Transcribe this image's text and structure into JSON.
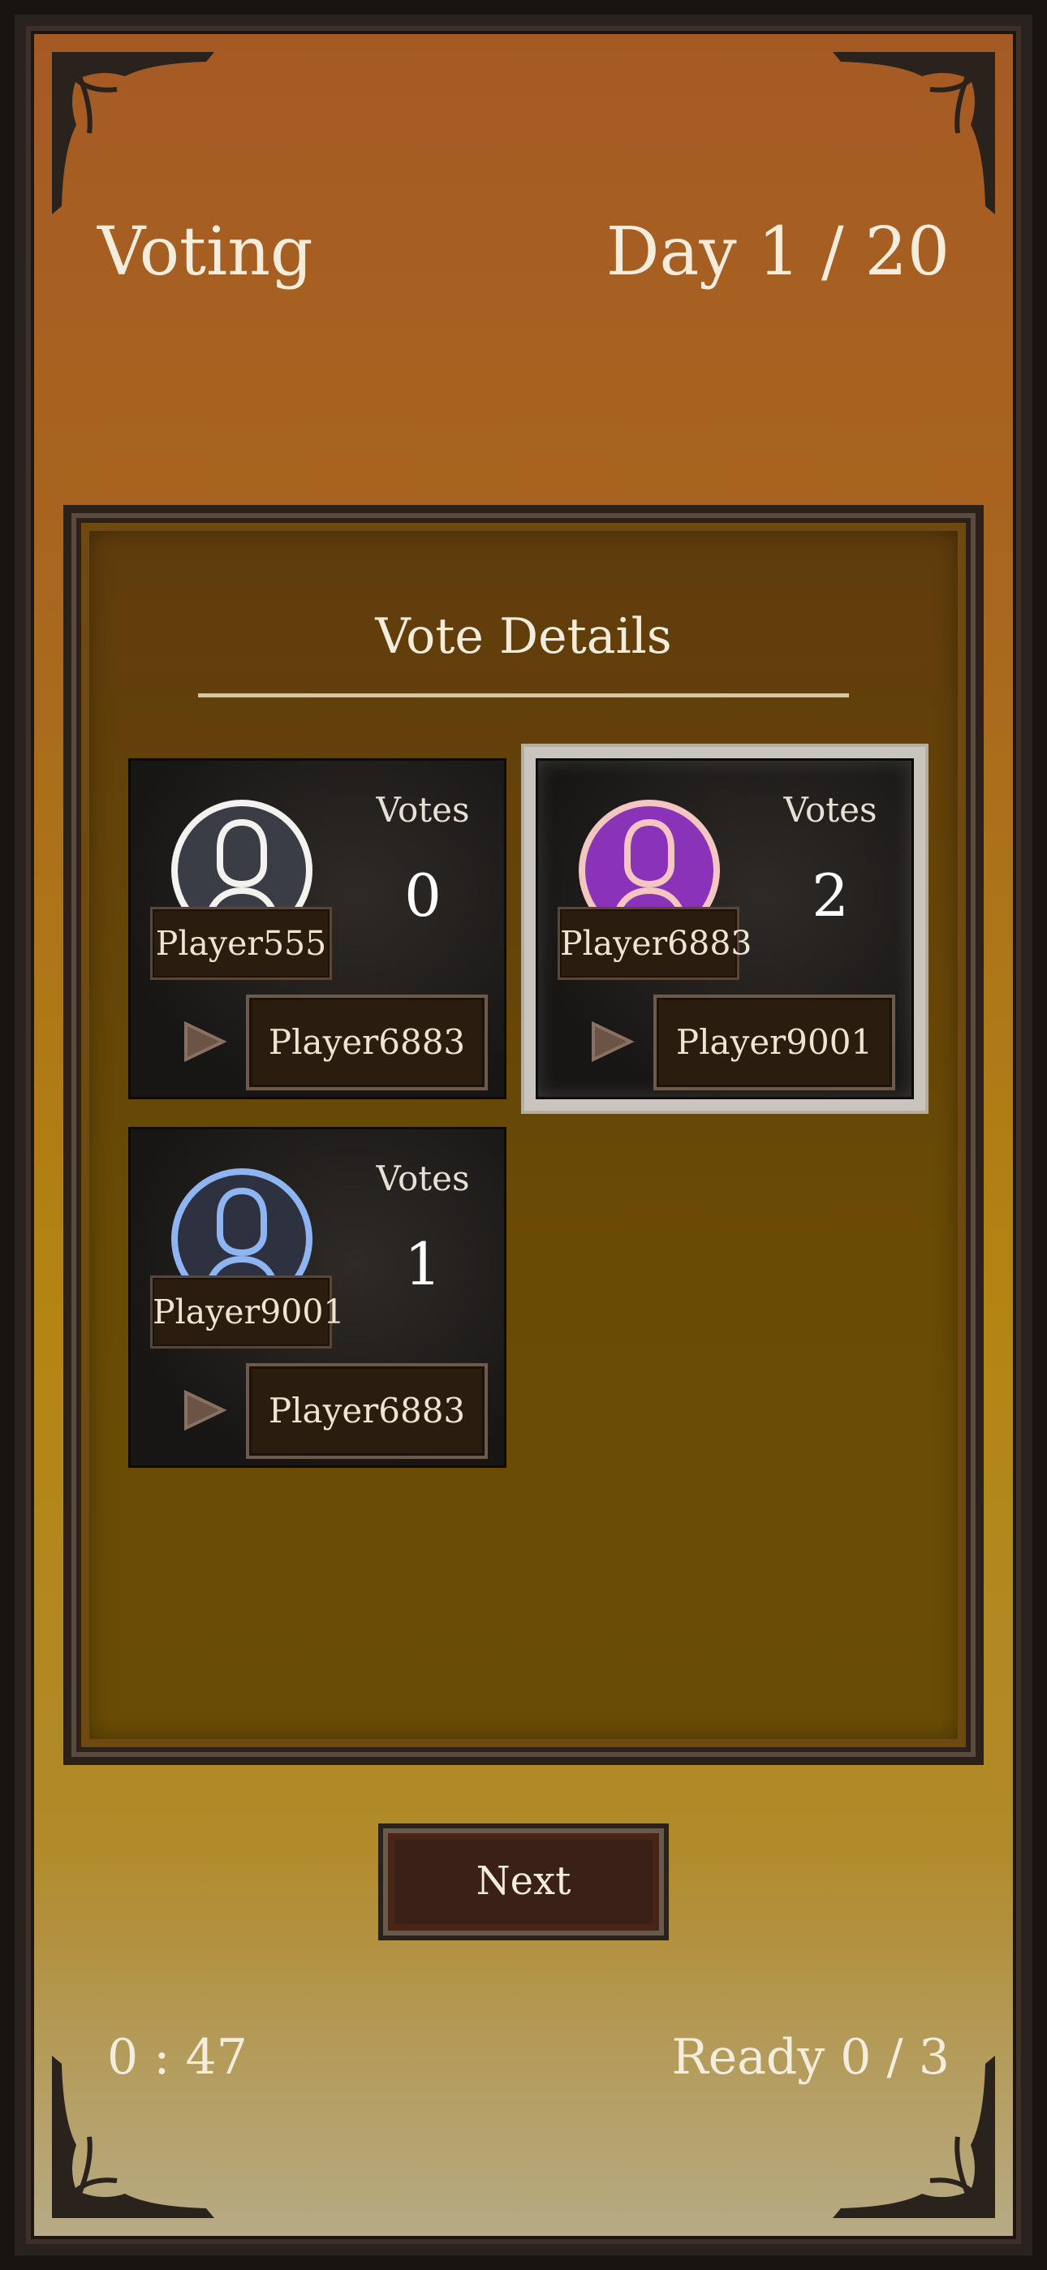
{
  "header": {
    "phase": "Voting",
    "day": "Day 1 / 20"
  },
  "panel": {
    "title": "Vote Details"
  },
  "cards": [
    {
      "player": "Player555",
      "votes_label": "Votes",
      "votes": "0",
      "voted_for": "Player6883",
      "avatar_color": "#3a3d45",
      "ring_color": "#f4f2ee",
      "selected": false
    },
    {
      "player": "Player6883",
      "votes_label": "Votes",
      "votes": "2",
      "voted_for": "Player9001",
      "avatar_color": "#8a32b8",
      "ring_color": "#f4c6c2",
      "selected": true
    },
    {
      "player": "Player9001",
      "votes_label": "Votes",
      "votes": "1",
      "voted_for": "Player6883",
      "avatar_color": "#2e3240",
      "ring_color": "#8eb4f2",
      "selected": false
    }
  ],
  "footer": {
    "next_label": "Next",
    "timer": "0 : 47",
    "ready": "Ready 0 / 3"
  }
}
